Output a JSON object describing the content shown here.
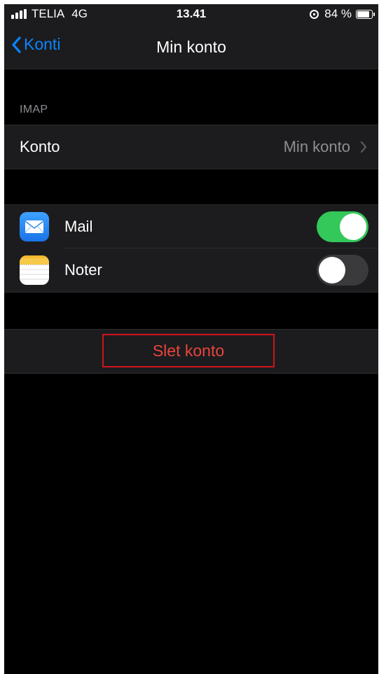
{
  "status_bar": {
    "carrier": "TELIA",
    "network": "4G",
    "time": "13.41",
    "battery_percent": "84 %",
    "battery_level": 0.84,
    "icons": [
      "signal-icon",
      "rotation-lock-icon",
      "battery-icon"
    ]
  },
  "nav": {
    "back_label": "Konti",
    "title": "Min konto"
  },
  "section": {
    "header": "IMAP"
  },
  "account_row": {
    "label": "Konto",
    "value": "Min konto"
  },
  "apps": [
    {
      "label": "Mail",
      "icon": "mail-icon",
      "enabled": true
    },
    {
      "label": "Noter",
      "icon": "notes-icon",
      "enabled": false
    }
  ],
  "delete_button": {
    "label": "Slet konto"
  },
  "colors": {
    "background": "#000000",
    "cell": "#1c1c1e",
    "accent": "#0a84ff",
    "toggle_on": "#34c759",
    "destructive": "#e8453c",
    "highlight_border": "#d0141c"
  }
}
